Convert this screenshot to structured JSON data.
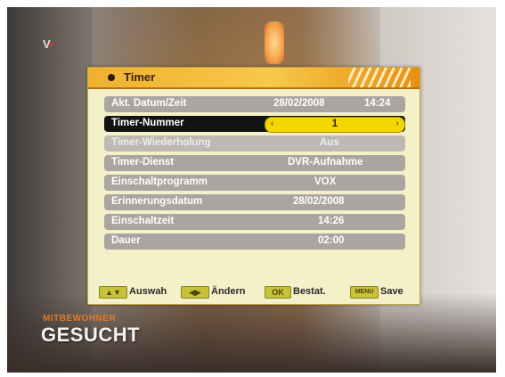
{
  "channel": {
    "logo_text": "V",
    "logo_dot": "•"
  },
  "osd": {
    "title": "Timer",
    "rows": [
      {
        "label": "Akt. Datum/Zeit",
        "date": "28/02/2008",
        "time": "14:24"
      },
      {
        "label": "Timer-Nummer",
        "value": "1"
      },
      {
        "label": "Timer-Wiederholung",
        "value": "Aus"
      },
      {
        "label": "Timer-Dienst",
        "value": "DVR-Aufnahme"
      },
      {
        "label": "Einschaltprogramm",
        "value": "VOX"
      },
      {
        "label": "Erinnerungsdatum",
        "value": "28/02/2008"
      },
      {
        "label": "Einschaltzeit",
        "value": "14:26"
      },
      {
        "label": "Dauer",
        "value": "02:00"
      }
    ],
    "spinner": {
      "left_arrow": "‹",
      "right_arrow": "›"
    },
    "footer": [
      {
        "key": "▲▼",
        "text": "Auswah"
      },
      {
        "key": "◀▶",
        "text": "Ändern"
      },
      {
        "key": "OK",
        "text": "Bestat."
      },
      {
        "key": "MENU",
        "text": "Save"
      }
    ]
  },
  "show": {
    "subtitle": "MITBEWOHNER",
    "title": "GESUCHT"
  },
  "colors": {
    "accent": "#f0b030",
    "selected": "#121212",
    "spinner": "#f2d800",
    "row": "#a9a5a0"
  }
}
